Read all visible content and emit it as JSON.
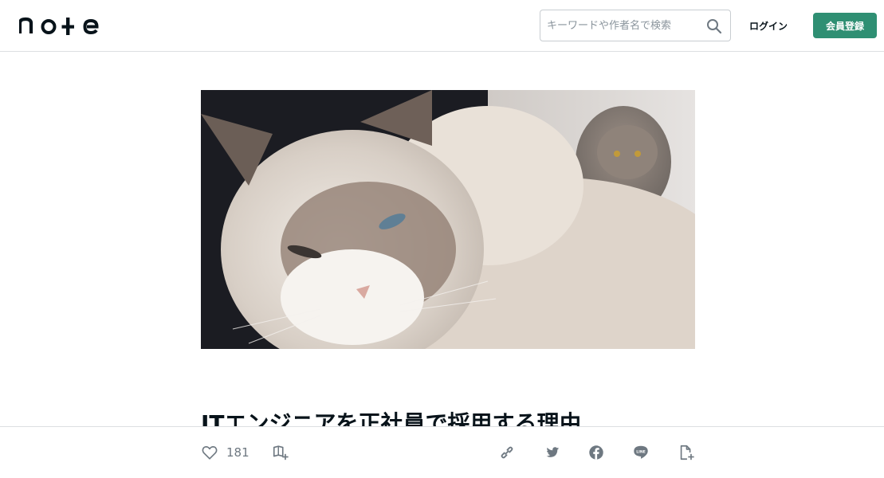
{
  "header": {
    "logo_text": "note",
    "search": {
      "placeholder": "キーワードや作者名で検索",
      "value": ""
    },
    "login_label": "ログイン",
    "register_label": "会員登録",
    "accent_color": "#2f8f73"
  },
  "article": {
    "title": "ITエンジニアを正社員で採用する理由"
  },
  "bottombar": {
    "like_count": "181",
    "icons": [
      "heart-icon",
      "magazine-add-icon",
      "link-icon",
      "twitter-icon",
      "facebook-icon",
      "line-icon",
      "document-add-icon"
    ]
  }
}
